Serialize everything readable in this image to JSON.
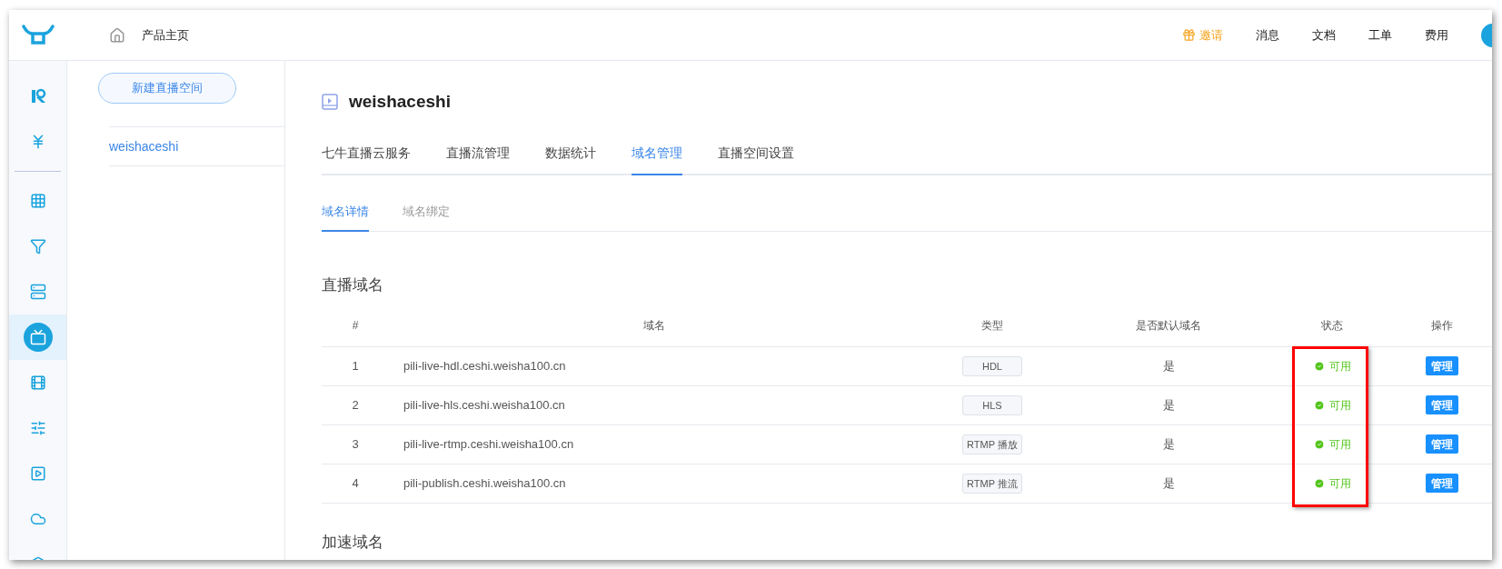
{
  "header": {
    "home_label": "产品主页",
    "nav": [
      {
        "label": "邀请",
        "kind": "invite"
      },
      {
        "label": "消息",
        "kind": "plain"
      },
      {
        "label": "文档",
        "kind": "plain"
      },
      {
        "label": "工单",
        "kind": "plain"
      },
      {
        "label": "费用",
        "kind": "plain"
      }
    ]
  },
  "rail": {
    "items": [
      {
        "selected": false
      },
      {
        "selected": false
      },
      {
        "selected": false
      },
      {
        "selected": false
      },
      {
        "selected": false
      },
      {
        "selected": true
      },
      {
        "selected": false
      },
      {
        "selected": false
      },
      {
        "selected": false
      },
      {
        "selected": false
      },
      {
        "selected": false
      }
    ]
  },
  "sidebar": {
    "new_button": "新建直播空间",
    "items": [
      {
        "label": "weishaceshi",
        "selected": true
      }
    ]
  },
  "space_title": "weishaceshi",
  "tabs": [
    {
      "label": "七牛直播云服务",
      "selected": false
    },
    {
      "label": "直播流管理",
      "selected": false
    },
    {
      "label": "数据统计",
      "selected": false
    },
    {
      "label": "域名管理",
      "selected": true
    },
    {
      "label": "直播空间设置",
      "selected": false
    }
  ],
  "sub_tabs": [
    {
      "label": "域名详情",
      "selected": true
    },
    {
      "label": "域名绑定",
      "selected": false
    }
  ],
  "section_title": "直播域名",
  "table": {
    "columns": [
      {
        "label": "#",
        "highlighted": false
      },
      {
        "label": "域名",
        "highlighted": false
      },
      {
        "label": "类型",
        "highlighted": false
      },
      {
        "label": "是否默认域名",
        "highlighted": false
      },
      {
        "label": "状态",
        "highlighted": true
      },
      {
        "label": "操作",
        "highlighted": false
      }
    ],
    "rows": [
      {
        "index": "1",
        "domain": "pili-live-hdl.ceshi.weisha100.cn",
        "type": "HDL",
        "default": "是",
        "status": {
          "text": "可用",
          "kind": "ok"
        },
        "action": "管理"
      },
      {
        "index": "2",
        "domain": "pili-live-hls.ceshi.weisha100.cn",
        "type": "HLS",
        "default": "是",
        "status": {
          "text": "可用",
          "kind": "ok"
        },
        "action": "管理"
      },
      {
        "index": "3",
        "domain": "pili-live-rtmp.ceshi.weisha100.cn",
        "type": "RTMP 播放",
        "default": "是",
        "status": {
          "text": "可用",
          "kind": "ok"
        },
        "action": "管理"
      },
      {
        "index": "4",
        "domain": "pili-publish.ceshi.weisha100.cn",
        "type": "RTMP 推流",
        "default": "是",
        "status": {
          "text": "可用",
          "kind": "ok"
        },
        "action": "管理"
      }
    ]
  },
  "section_title_2": "加速域名"
}
